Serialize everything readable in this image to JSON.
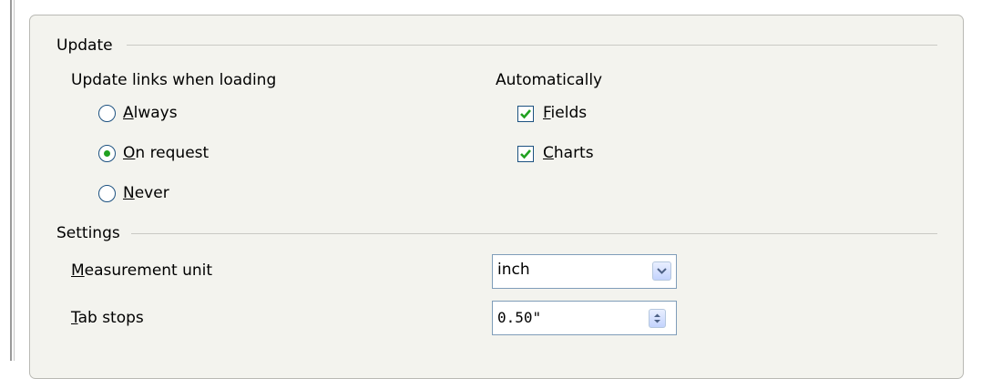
{
  "update": {
    "section_title": "Update",
    "links_heading": "Update links when loading",
    "radio_options": [
      {
        "pre": "",
        "mnemonic": "A",
        "post": "lways",
        "checked": false
      },
      {
        "pre": "",
        "mnemonic": "O",
        "post": "n request",
        "checked": true
      },
      {
        "pre": "",
        "mnemonic": "N",
        "post": "ever",
        "checked": false
      }
    ],
    "auto_heading": "Automatically",
    "checkboxes": [
      {
        "pre": "",
        "mnemonic": "F",
        "post": "ields",
        "checked": true
      },
      {
        "pre": "",
        "mnemonic": "C",
        "post": "harts",
        "checked": true
      }
    ]
  },
  "settings": {
    "section_title": "Settings",
    "measurement": {
      "pre": "",
      "mnemonic": "M",
      "post": "easurement unit",
      "value": "inch"
    },
    "tabstops": {
      "pre": "",
      "mnemonic": "T",
      "post": "ab stops",
      "value": "0.50\""
    }
  },
  "colors": {
    "panel_bg": "#f3f3ee",
    "control_border": "#1c5180",
    "check_green": "#21a121",
    "field_border": "#7f9db9"
  },
  "icons": {
    "dropdown": "chevron-down-icon",
    "spinner": "spin-up-down-icon"
  }
}
